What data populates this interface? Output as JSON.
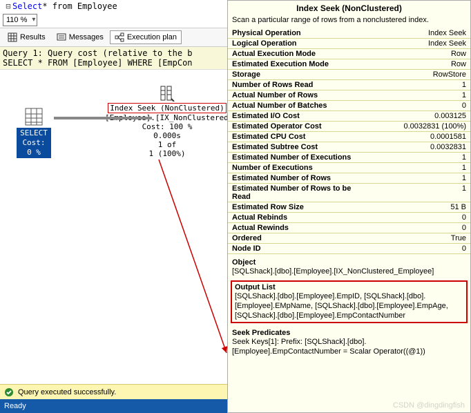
{
  "editor": {
    "sql_keyword": "Select",
    "sql_rest": " * from Employee"
  },
  "zoom": {
    "value": "110 %"
  },
  "tabs": {
    "results": "Results",
    "messages": "Messages",
    "execution_plan": "Execution plan"
  },
  "query_band": {
    "line1": "Query 1: Query cost (relative to the b",
    "line2": "SELECT * FROM [Employee] WHERE [EmpCon"
  },
  "plan": {
    "select_label": "SELECT",
    "select_cost": "Cost: 0 %",
    "seek_title": "Index Seek (NonClustered)",
    "seek_object": "[Employee].[IX_NonClustered_Emp",
    "seek_cost": "Cost: 100 %",
    "seek_time": "0.000s",
    "seek_rows_1": "1 of",
    "seek_rows_2": "1 (100%)"
  },
  "tooltip": {
    "title": "Index Seek (NonClustered)",
    "desc": "Scan a particular range of rows from a nonclustered index.",
    "rows": [
      {
        "k": "Physical Operation",
        "v": "Index Seek"
      },
      {
        "k": "Logical Operation",
        "v": "Index Seek"
      },
      {
        "k": "Actual Execution Mode",
        "v": "Row"
      },
      {
        "k": "Estimated Execution Mode",
        "v": "Row"
      },
      {
        "k": "Storage",
        "v": "RowStore"
      },
      {
        "k": "Number of Rows Read",
        "v": "1"
      },
      {
        "k": "Actual Number of Rows",
        "v": "1"
      },
      {
        "k": "Actual Number of Batches",
        "v": "0"
      },
      {
        "k": "Estimated I/O Cost",
        "v": "0.003125"
      },
      {
        "k": "Estimated Operator Cost",
        "v": "0.0032831 (100%)"
      },
      {
        "k": "Estimated CPU Cost",
        "v": "0.0001581"
      },
      {
        "k": "Estimated Subtree Cost",
        "v": "0.0032831"
      },
      {
        "k": "Estimated Number of Executions",
        "v": "1"
      },
      {
        "k": "Number of Executions",
        "v": "1"
      },
      {
        "k": "Estimated Number of Rows",
        "v": "1"
      },
      {
        "k": "Estimated Number of Rows to be Read",
        "v": "1"
      },
      {
        "k": "Estimated Row Size",
        "v": "51 B"
      },
      {
        "k": "Actual Rebinds",
        "v": "0"
      },
      {
        "k": "Actual Rewinds",
        "v": "0"
      },
      {
        "k": "Ordered",
        "v": "True"
      },
      {
        "k": "Node ID",
        "v": "0"
      }
    ],
    "object_heading": "Object",
    "object_value": "[SQLShack].[dbo].[Employee].[IX_NonClustered_Employee]",
    "output_heading": "Output List",
    "output_value": "[SQLShack].[dbo].[Employee].EmpID, [SQLShack].[dbo].[Employee].EMpName, [SQLShack].[dbo].[Employee].EmpAge, [SQLShack].[dbo].[Employee].EmpContactNumber",
    "seek_pred_heading": "Seek Predicates",
    "seek_pred_value": "Seek Keys[1]: Prefix: [SQLShack].[dbo].[Employee].EmpContactNumber = Scalar Operator((@1))"
  },
  "status": {
    "text": "Query executed successfully."
  },
  "ready": {
    "text": "Ready"
  },
  "watermark": "CSDN @dingdingfish"
}
